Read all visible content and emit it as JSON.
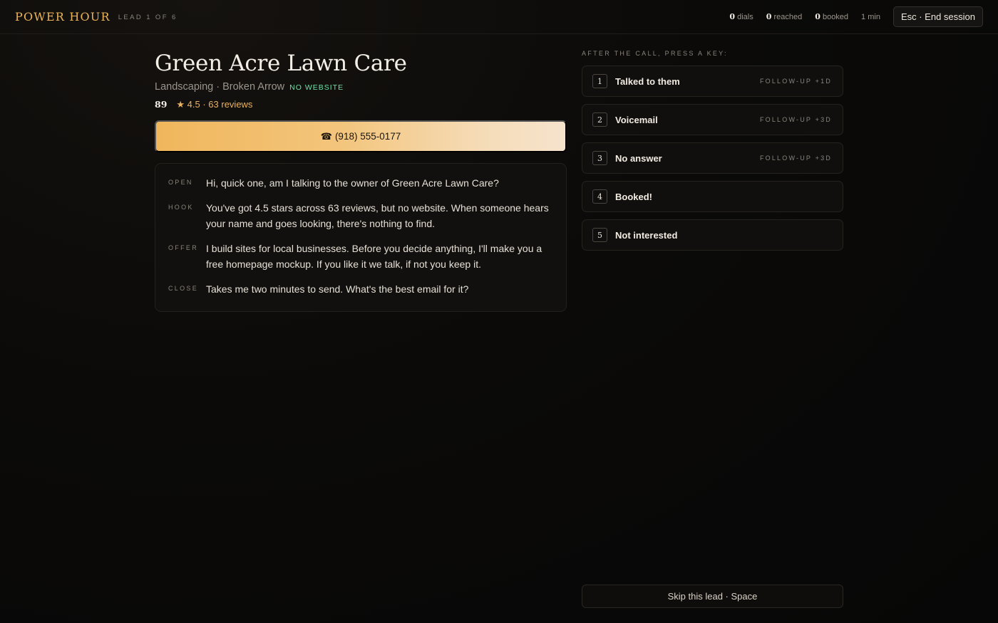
{
  "header": {
    "brand": "POWER HOUR",
    "lead_counter": "LEAD 1 OF 6",
    "stats": [
      {
        "value": "0",
        "label": "dials"
      },
      {
        "value": "0",
        "label": "reached"
      },
      {
        "value": "0",
        "label": "booked"
      }
    ],
    "timer": "1 min",
    "end_label": "Esc · End session"
  },
  "lead": {
    "name": "Green Acre Lawn Care",
    "meta": "Landscaping · Broken Arrow",
    "tag": "NO WEBSITE",
    "score": "89",
    "rating": "★ 4.5 · 63 reviews",
    "phone_icon": "☎",
    "phone": "(918) 555-0177"
  },
  "script": [
    {
      "label": "OPEN",
      "text": "Hi, quick one, am I talking to the owner of Green Acre Lawn Care?"
    },
    {
      "label": "HOOK",
      "text": "You've got 4.5 stars across 63 reviews, but no website. When someone hears your name and goes looking, there's nothing to find."
    },
    {
      "label": "OFFER",
      "text": "I build sites for local businesses. Before you decide anything, I'll make you a free homepage mockup. If you like it we talk, if not you keep it."
    },
    {
      "label": "CLOSE",
      "text": "Takes me two minutes to send. What's the best email for it?"
    }
  ],
  "outcomes": {
    "hint": "AFTER THE CALL, PRESS A KEY:",
    "options": [
      {
        "key": "1",
        "label": "Talked to them",
        "followup": "FOLLOW-UP +1D"
      },
      {
        "key": "2",
        "label": "Voicemail",
        "followup": "FOLLOW-UP +3D"
      },
      {
        "key": "3",
        "label": "No answer",
        "followup": "FOLLOW-UP +3D"
      },
      {
        "key": "4",
        "label": "Booked!",
        "followup": ""
      },
      {
        "key": "5",
        "label": "Not interested",
        "followup": ""
      }
    ]
  },
  "skip_label": "Skip this lead · Space"
}
